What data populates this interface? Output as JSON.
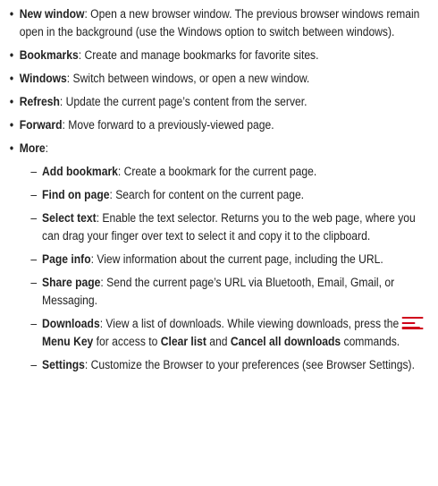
{
  "bullet_char": "•",
  "dash_char": "–",
  "items": [
    {
      "term": "New window",
      "desc": ": Open a new browser window. The previous browser windows remain open in the background (use the Windows option to switch between windows)."
    },
    {
      "term": "Bookmarks",
      "desc": ": Create and manage bookmarks for favorite sites."
    },
    {
      "term": "Windows",
      "desc": ": Switch between windows, or open a new window."
    },
    {
      "term": "Refresh",
      "desc": ": Update the current page’s content from the server."
    },
    {
      "term": "Forward",
      "desc": ": Move forward to a previously-viewed page."
    },
    {
      "term": "More",
      "desc": ":"
    }
  ],
  "more_items": [
    {
      "term": "Add bookmark",
      "desc": ": Create a bookmark for the current page."
    },
    {
      "term": "Find on page",
      "desc": ": Search for content on the current page."
    },
    {
      "term": "Select text",
      "desc": ": Enable the text selector. Returns you to the web page, where you can drag your finger over text to select it and copy it to the clipboard."
    },
    {
      "term": "Page info",
      "desc": ": View information about the current page, including the URL."
    },
    {
      "term": "Share page",
      "desc": ": Send the current page’s URL via Bluetooth, Email, Gmail, or Messaging."
    }
  ],
  "downloads": {
    "term": "Downloads",
    "desc_a": ": View a list of downloads. While viewing downloads, press the ",
    "menu_key_label": "Menu Key",
    "desc_b": " for access to ",
    "clear_list": "Clear list",
    "and": " and ",
    "cancel_all": "Cancel all downloads",
    "desc_c": " commands.",
    "menu_icon_name": "menu-key-icon",
    "menu_icon_color": "#d0021b"
  },
  "settings": {
    "term": "Settings",
    "desc": ": Customize the Browser to your preferences (see Browser Settings)."
  }
}
